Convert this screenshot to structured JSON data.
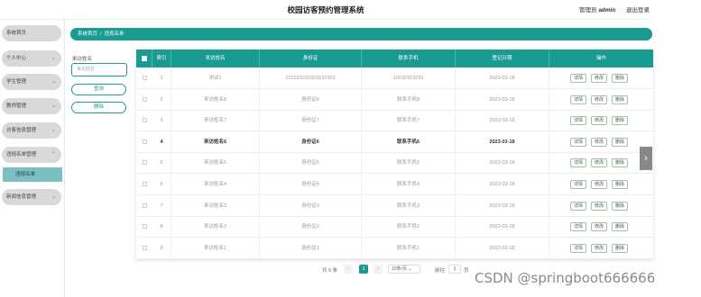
{
  "header": {
    "title": "校园访客预约管理系统",
    "admin_label": "管理员",
    "admin_name": "admin",
    "logout": "退出登录"
  },
  "sidebar": {
    "items": [
      {
        "label": "系统首页"
      },
      {
        "label": "个人中心"
      },
      {
        "label": "学生管理"
      },
      {
        "label": "教师管理"
      },
      {
        "label": "访客信息管理"
      },
      {
        "label": "违规名单管理"
      },
      {
        "label": "新闻信息管理"
      }
    ],
    "sub_item": "违规名单"
  },
  "breadcrumb": {
    "home": "系统首页",
    "sep": "/",
    "current": "违规名单"
  },
  "search": {
    "label": "来访姓名",
    "placeholder": "来访姓名",
    "query_button": "查询",
    "delete_button": "删除"
  },
  "table": {
    "columns": [
      "索引",
      "来访姓名",
      "身份证",
      "联系手机",
      "登记日期",
      "操作"
    ],
    "actions": [
      "详情",
      "修改",
      "删除"
    ],
    "rows": [
      {
        "index": "1",
        "name": "测试1",
        "id": "232323232323232323",
        "phone": "13232323232",
        "date": "2023-03-18"
      },
      {
        "index": "2",
        "name": "来访姓名8",
        "id": "身份证8",
        "phone": "联系手机8",
        "date": "2023-03-18"
      },
      {
        "index": "3",
        "name": "来访姓名7",
        "id": "身份证7",
        "phone": "联系手机7",
        "date": "2023-03-18"
      },
      {
        "index": "4",
        "name": "来访姓名6",
        "id": "身份证6",
        "phone": "联系手机6",
        "date": "2023-03-18"
      },
      {
        "index": "5",
        "name": "来访姓名5",
        "id": "身份证5",
        "phone": "联系手机5",
        "date": "2023-03-18"
      },
      {
        "index": "6",
        "name": "来访姓名4",
        "id": "身份证4",
        "phone": "联系手机4",
        "date": "2023-03-18"
      },
      {
        "index": "7",
        "name": "来访姓名3",
        "id": "身份证3",
        "phone": "联系手机3",
        "date": "2023-03-18"
      },
      {
        "index": "8",
        "name": "来访姓名2",
        "id": "身份证2",
        "phone": "联系手机2",
        "date": "2023-03-18"
      },
      {
        "index": "9",
        "name": "来访姓名1",
        "id": "身份证1",
        "phone": "联系手机1",
        "date": "2023-03-18"
      }
    ]
  },
  "pager": {
    "total": "共 9 条",
    "prev": "‹",
    "current": "1",
    "next": "›",
    "page_size": "10条/页",
    "goto_label": "前往",
    "goto_value": "1",
    "page_suffix": "页"
  },
  "watermark": "CSDN @springboot666666",
  "colors": {
    "accent": "#1a9b92",
    "sidebar_active": "#7bbfbf"
  }
}
